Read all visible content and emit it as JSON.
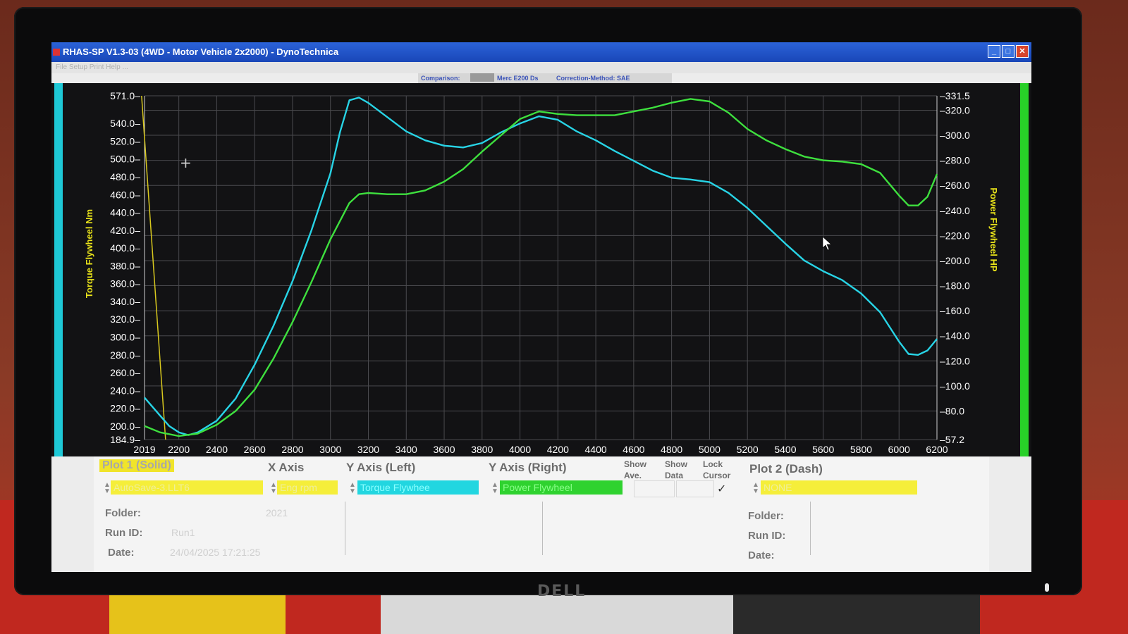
{
  "window": {
    "title": "RHAS-SP V1.3-03  (4WD - Motor Vehicle 2x2000) - DynoTechnica",
    "menu": "File  Setup  Print  Help  ...",
    "comparison_label": "Comparison:",
    "comparison_value": "Merc E200 Ds",
    "correction_label": "Correction-Method: SAE"
  },
  "colors": {
    "torque": "#28d4e6",
    "power": "#3ee03e",
    "cursor": "#d8c81e",
    "plot_bg": "#121214",
    "left_strip": "#1ec8d6",
    "right_strip": "#28d028"
  },
  "chart_data": {
    "type": "line",
    "ylabel_left": "Torque Flywheel Nm",
    "ylabel_right": "Power Flywheel HP",
    "x_ticks": [
      "2019",
      "2200",
      "2400",
      "2600",
      "2800",
      "3000",
      "3200",
      "3400",
      "3600",
      "3800",
      "4000",
      "4200",
      "4400",
      "4600",
      "4800",
      "5000",
      "5200",
      "5400",
      "5600",
      "5800",
      "6000",
      "6200"
    ],
    "y_left_ticks": [
      "571.0",
      "540.0",
      "520.0",
      "500.0",
      "480.0",
      "460.0",
      "440.0",
      "420.0",
      "400.0",
      "380.0",
      "360.0",
      "340.0",
      "320.0",
      "300.0",
      "280.0",
      "260.0",
      "240.0",
      "220.0",
      "200.0",
      "184.9"
    ],
    "y_right_ticks": [
      "331.5",
      "320.0",
      "300.0",
      "280.0",
      "260.0",
      "240.0",
      "220.0",
      "200.0",
      "180.0",
      "160.0",
      "140.0",
      "120.0",
      "100.0",
      "80.0",
      "57.2"
    ],
    "xlim": [
      2019,
      6200
    ],
    "ylim_left": [
      184.9,
      571.0
    ],
    "ylim_right": [
      57.2,
      331.5
    ],
    "cursor_rpm": 2130,
    "grid": true,
    "series": [
      {
        "axis": "left",
        "x": [
          2019,
          2100,
          2150,
          2200,
          2250,
          2300,
          2400,
          2500,
          2600,
          2700,
          2800,
          2900,
          3000,
          3050,
          3100,
          3150,
          3200,
          3300,
          3400,
          3500,
          3600,
          3700,
          3800,
          3900,
          4000,
          4100,
          4200,
          4300,
          4400,
          4500,
          4600,
          4700,
          4800,
          4900,
          5000,
          5100,
          5200,
          5300,
          5400,
          5500,
          5600,
          5700,
          5800,
          5900,
          6000,
          6050,
          6100,
          6150,
          6200
        ],
        "y": [
          232,
          212,
          200,
          193,
          190,
          193,
          206,
          231,
          269,
          313,
          363,
          420,
          484,
          530,
          566,
          569,
          563,
          547,
          531,
          521,
          515,
          513,
          518,
          530,
          540,
          548,
          544,
          531,
          521,
          509,
          498,
          487,
          479,
          477,
          474,
          462,
          445,
          425,
          405,
          386,
          374,
          364,
          349,
          328,
          295,
          281,
          280,
          285,
          298
        ]
      },
      {
        "axis": "right",
        "x": [
          2019,
          2100,
          2200,
          2300,
          2400,
          2500,
          2600,
          2700,
          2800,
          2900,
          3000,
          3100,
          3150,
          3200,
          3300,
          3400,
          3500,
          3600,
          3700,
          3800,
          3900,
          4000,
          4100,
          4200,
          4300,
          4400,
          4500,
          4600,
          4700,
          4800,
          4900,
          5000,
          5100,
          5200,
          5300,
          5400,
          5500,
          5600,
          5700,
          5800,
          5900,
          6000,
          6050,
          6100,
          6150,
          6200
        ],
        "y": [
          68,
          63,
          60,
          62,
          69,
          80,
          97,
          122,
          151,
          183,
          217,
          246,
          253,
          254,
          253,
          253,
          256,
          263,
          273,
          287,
          300,
          313,
          319,
          317,
          316,
          316,
          316,
          319,
          322,
          326,
          329,
          327,
          318,
          305,
          296,
          289,
          283,
          280,
          279,
          277,
          270,
          252,
          244,
          244,
          251,
          269
        ]
      }
    ]
  },
  "panel": {
    "plot1_title": "Plot 1 (Solid)",
    "x_axis_title": "X Axis",
    "y_left_title": "Y Axis (Left)",
    "y_right_title": "Y Axis (Right)",
    "show_ave_1": "Show",
    "show_ave_2": "Ave.",
    "show_data_1": "Show",
    "show_data_2": "Data",
    "lock_cursor_1": "Lock",
    "lock_cursor_2": "Cursor",
    "plot2_title": "Plot 2 (Dash)",
    "plot1_file": "AutoSave-3.LLT6",
    "x_axis_value": "Eng rpm",
    "y_left_value": "Torque Flywhee",
    "y_right_value": "Power Flywheel",
    "plot2_file": "NONE",
    "lock_check": "✓",
    "folder_label": "Folder:",
    "runid_label": "Run ID:",
    "date_label": "Date:",
    "folder_value": "2021",
    "runid_value": "Run1",
    "date_value": "24/04/2025  17:21:25",
    "folder2_label": "Folder:",
    "runid2_label": "Run ID:",
    "date2_label": "Date:"
  },
  "device": {
    "brand": "DELL"
  }
}
